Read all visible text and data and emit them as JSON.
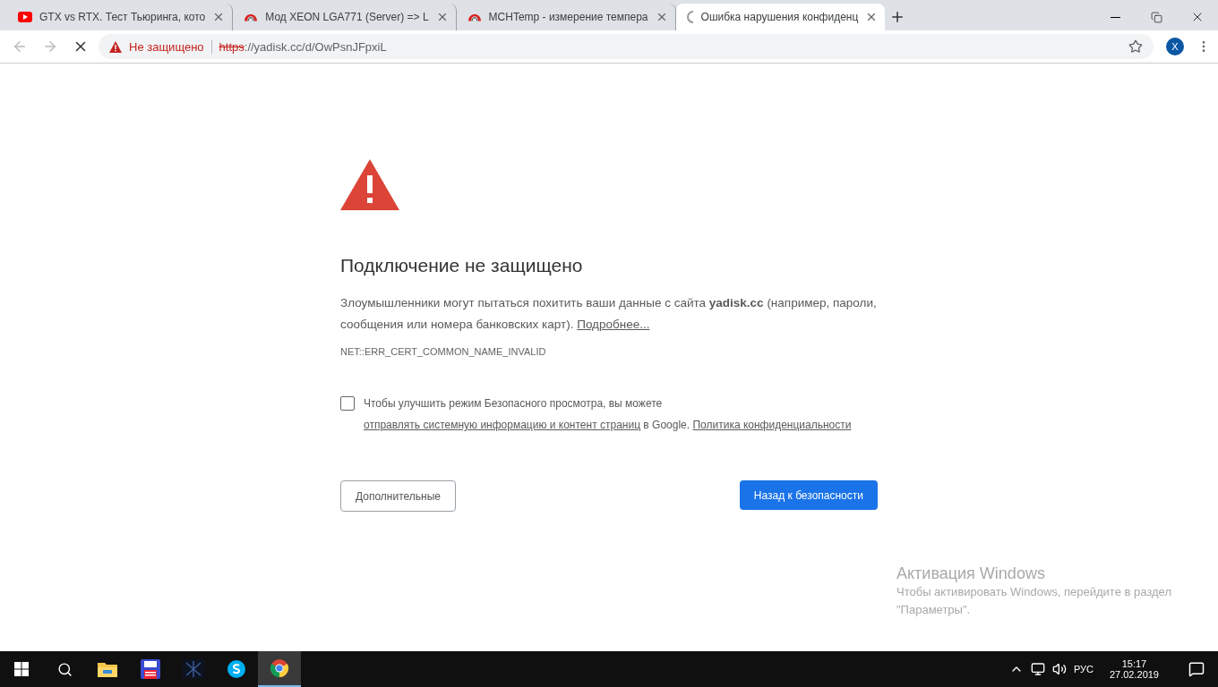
{
  "tabs": [
    {
      "title": "GTX vs RTX. Тест Тьюринга, кото",
      "kind": "video",
      "selected": false
    },
    {
      "title": "Мод XEON LGA771 (Server) => L",
      "kind": "arc",
      "selected": false
    },
    {
      "title": "MCHTemp - измерение темпера",
      "kind": "arc",
      "selected": false
    },
    {
      "title": "Ошибка нарушения конфиденц",
      "kind": "loading",
      "selected": true
    }
  ],
  "toolbar": {
    "security_label": "Не защищено",
    "url_scheme": "https",
    "url_rest": "://yadisk.cc/d/OwPsnJFpxiL",
    "profile_initial": "X"
  },
  "error": {
    "heading": "Подключение не защищено",
    "paragraph": [
      {
        "kind": "text",
        "text": "Злоумышленники могут пытаться похитить ваши данные с сайта "
      },
      {
        "kind": "bold",
        "text": "yadisk.cc"
      },
      {
        "kind": "text",
        "text": " (например, пароли, сообщения или номера банковских карт). "
      },
      {
        "kind": "link",
        "text": "Подробнее..."
      }
    ],
    "code": "NET::ERR_CERT_COMMON_NAME_INVALID",
    "optin": {
      "checked": false,
      "parts": [
        {
          "kind": "text",
          "text": "Чтобы улучшить режим Безопасного просмотра, вы можете "
        },
        {
          "kind": "link",
          "text": "отправлять системную информацию и контент страниц"
        },
        {
          "kind": "text",
          "text": " в Google. "
        },
        {
          "kind": "link",
          "text": "Политика конфиденциальности"
        }
      ]
    },
    "advanced_button": "Дополнительные",
    "back_button": "Назад к безопасности"
  },
  "activation": {
    "title": "Активация Windows",
    "text": "Чтобы активировать Windows, перейдите в раздел \"Параметры\"."
  },
  "taskbar": {
    "apps": [
      {
        "kind": "explorer",
        "selected": false
      },
      {
        "kind": "save",
        "selected": false
      },
      {
        "kind": "dark",
        "selected": false
      },
      {
        "kind": "skype",
        "selected": false
      },
      {
        "kind": "chrome",
        "selected": true
      }
    ],
    "language": "РУС",
    "time": "15:17",
    "date": "27.02.2019"
  }
}
